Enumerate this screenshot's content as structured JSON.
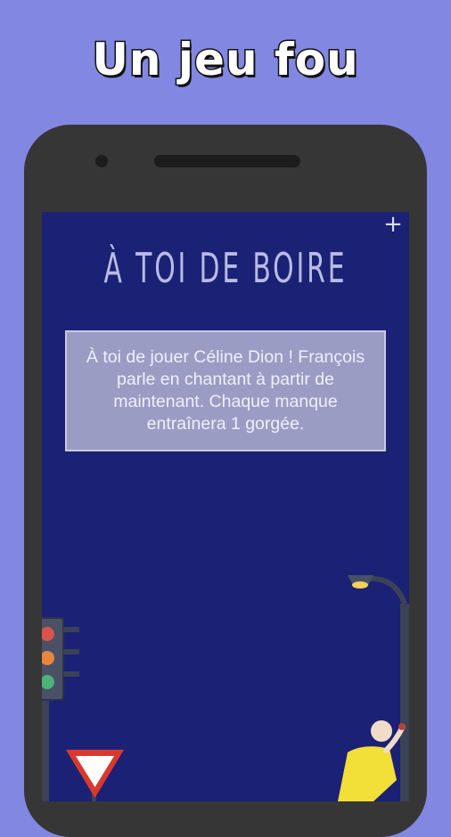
{
  "promo": {
    "headline": "Un jeu fou"
  },
  "screen": {
    "title": "À TOI DE BOIRE",
    "plus_label": "+",
    "card_text": "À toi de jouer Céline Dion ! François parle en chantant à partir de maintenant. Chaque manque entraînera 1 gorgée."
  },
  "colors": {
    "background": "#8287e2",
    "phone": "#363636",
    "screen": "#1b2174",
    "card": "#9a9cc4"
  },
  "icons": [
    "traffic-light-icon",
    "yield-sign-icon",
    "street-lamp-icon",
    "drunk-person-icon"
  ]
}
